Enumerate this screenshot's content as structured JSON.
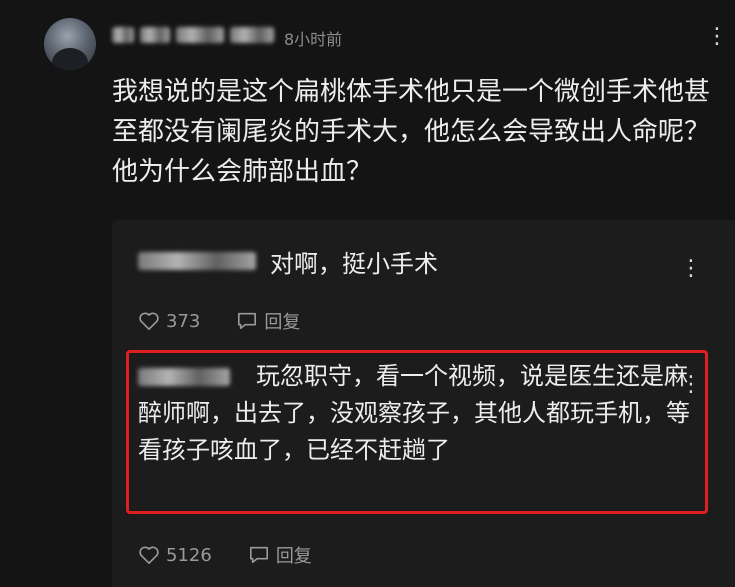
{
  "post": {
    "timestamp": "8小时前",
    "more": "⋮",
    "text": "我想说的是这个扁桃体手术他只是一个微创手术他甚至都没有阑尾炎的手术大，他怎么会导致出人命呢？他为什么会肺部出血？"
  },
  "replies": [
    {
      "text": "对啊，挺小手术",
      "more": "⋮",
      "likes": "373",
      "reply_label": "回复"
    },
    {
      "text": "玩忽职守，看一个视频，说是医生还是麻醉师啊，出去了，没观察孩子，其他人都玩手机，等看孩子咳血了，已经不赶趟了",
      "more": "⋮",
      "likes": "5126",
      "reply_label": "回复"
    }
  ],
  "colors": {
    "background": "#141414",
    "panel": "#1c1c1c",
    "highlight_border": "#e02020",
    "muted_text": "#9a9a9a"
  },
  "icons": [
    "heart-icon",
    "comment-icon",
    "more-icon"
  ]
}
